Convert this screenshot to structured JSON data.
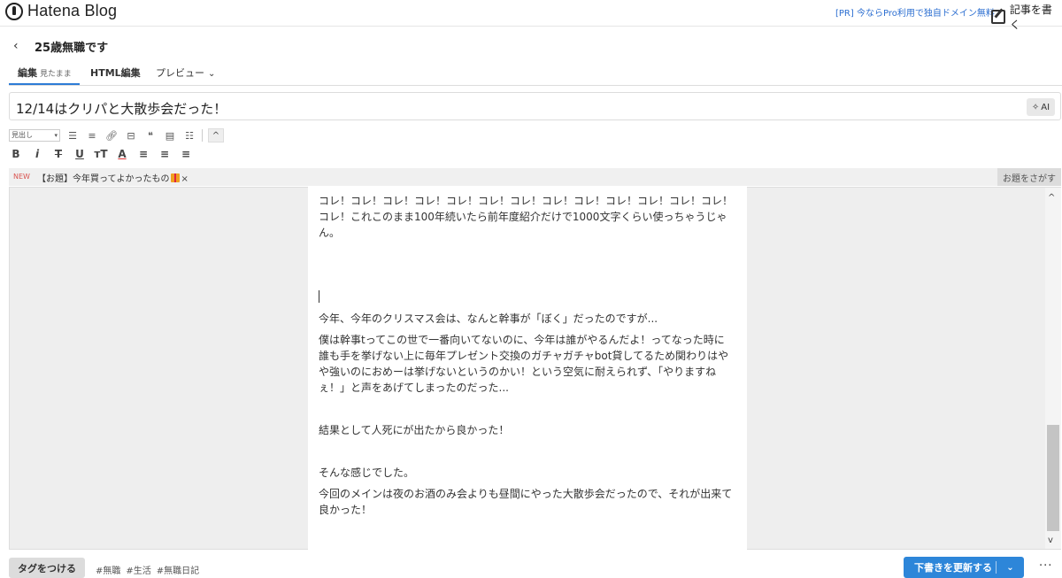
{
  "header": {
    "logo_text": "Hatena Blog",
    "pr_link": "[PR] 今ならPro利用で独自ドメイン無料",
    "write_label": "記事を書く"
  },
  "blog": {
    "back": "‹",
    "name": "25歳無職です"
  },
  "tabs": {
    "edit_label": "編集",
    "edit_sub": "見たまま",
    "html_label": "HTML編集",
    "preview_label": "プレビュー",
    "preview_caret": "⌄"
  },
  "title_input": {
    "value": "12/14はクリパと大散歩会だった！",
    "ai_label": "AI"
  },
  "toolbar": {
    "heading_select": "見出し"
  },
  "topic": {
    "new_badge": "NEW",
    "text": "【お題】今年買ってよかったもの",
    "close": "×",
    "search_label": "お題をさがす"
  },
  "editor": {
    "paragraphs": [
      "コレ！コレ！コレ！コレ！コレ！コレ！コレ！コレ！コレ！コレ！コレ！コレ！コレ！コレ！これこのまま100年続いたら前年度紹介だけで1000文字くらい使っちゃうじゃん。",
      "今年、今年のクリスマス会は、なんと幹事が「ぼく」だったのですが...",
      "僕は幹事tってこの世で一番向いてないのに、今年は誰がやるんだよ！ってなった時に誰も手を挙げない上に毎年プレゼント交換のガチャガチャbot貸してるため関わりはやや強いのにおめーは挙げないというのかい！という空気に耐えられず、「やりますねぇ！」と声をあげてしまったのだった...",
      "結果として人死にが出たから良かった！",
      "そんな感じでした。",
      "今回のメインは夜のお酒のみ会よりも昼間にやった大散歩会だったので、それが出来て良かった！"
    ]
  },
  "footer": {
    "tag_button": "タグをつける",
    "tags": [
      "#無職",
      "#生活",
      "#無職日記"
    ],
    "save_label": "下書きを更新する",
    "more": "···"
  }
}
